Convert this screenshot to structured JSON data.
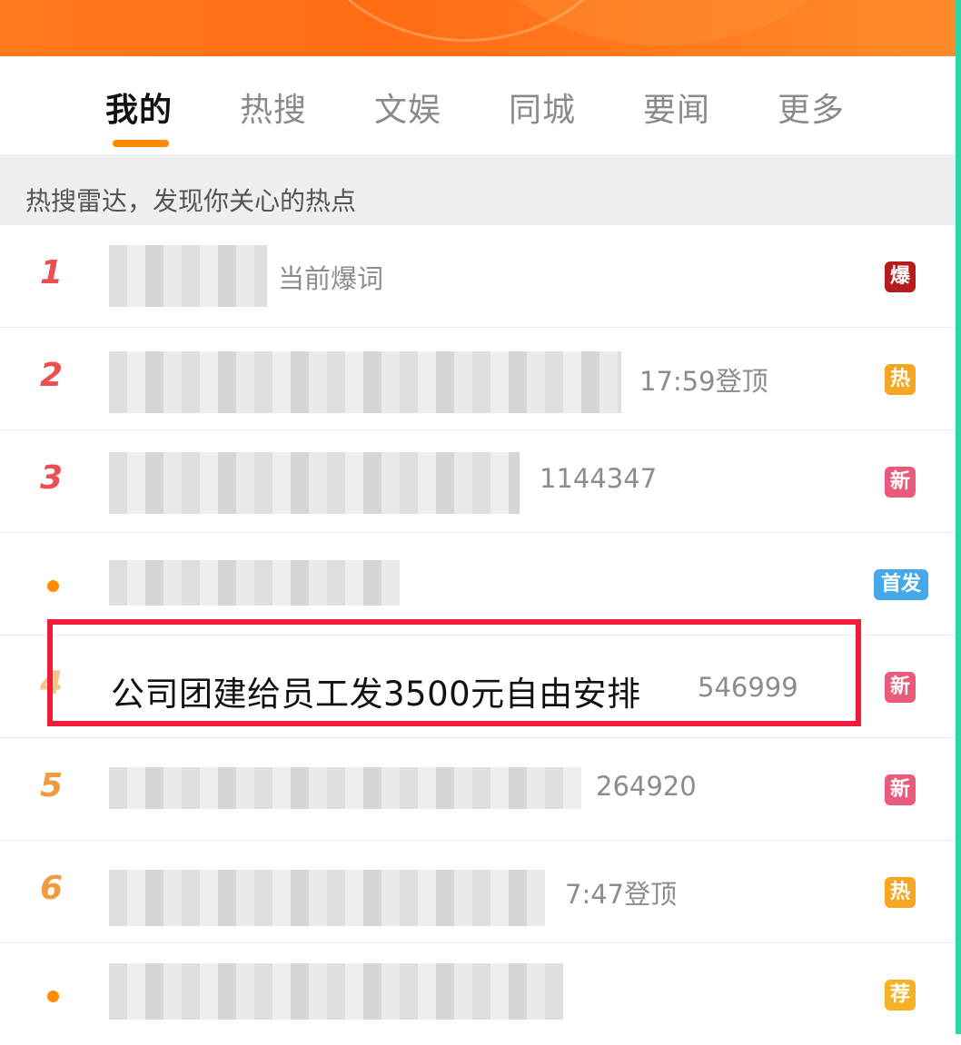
{
  "tabs": [
    {
      "label": "我的",
      "active": true
    },
    {
      "label": "热搜",
      "active": false
    },
    {
      "label": "文娱",
      "active": false
    },
    {
      "label": "同城",
      "active": false
    },
    {
      "label": "要闻",
      "active": false
    },
    {
      "label": "更多",
      "active": false
    }
  ],
  "radar_text": "热搜雷达，发现你关心的热点",
  "rows": [
    {
      "rank": "1",
      "meta": "当前爆词",
      "tag": "爆",
      "tag_color": "#b71c1c"
    },
    {
      "rank": "2",
      "meta": "17:59登顶",
      "tag": "热",
      "tag_color": "#f5a623"
    },
    {
      "rank": "3",
      "meta": "1144347",
      "tag": "新",
      "tag_color": "#ea5a7a"
    },
    {
      "rank": "•",
      "meta": "",
      "tag": "首发",
      "tag_color": "#46a8ea"
    },
    {
      "rank": "4",
      "title": "公司团建给员工发3500元自由安排",
      "meta": "546999",
      "tag": "新",
      "tag_color": "#ea5a7a"
    },
    {
      "rank": "5",
      "meta": "264920",
      "tag": "新",
      "tag_color": "#ea5a7a"
    },
    {
      "rank": "6",
      "meta": "7:47登顶",
      "tag": "热",
      "tag_color": "#f5a623"
    },
    {
      "rank": "•",
      "meta": "",
      "tag": "荐",
      "tag_color": "#f5b324"
    }
  ],
  "colors": {
    "accent": "#ff8c00",
    "rank_red": "#e9504f",
    "rank_orange": "#f29a3d",
    "highlight": "#ee1d3c"
  }
}
